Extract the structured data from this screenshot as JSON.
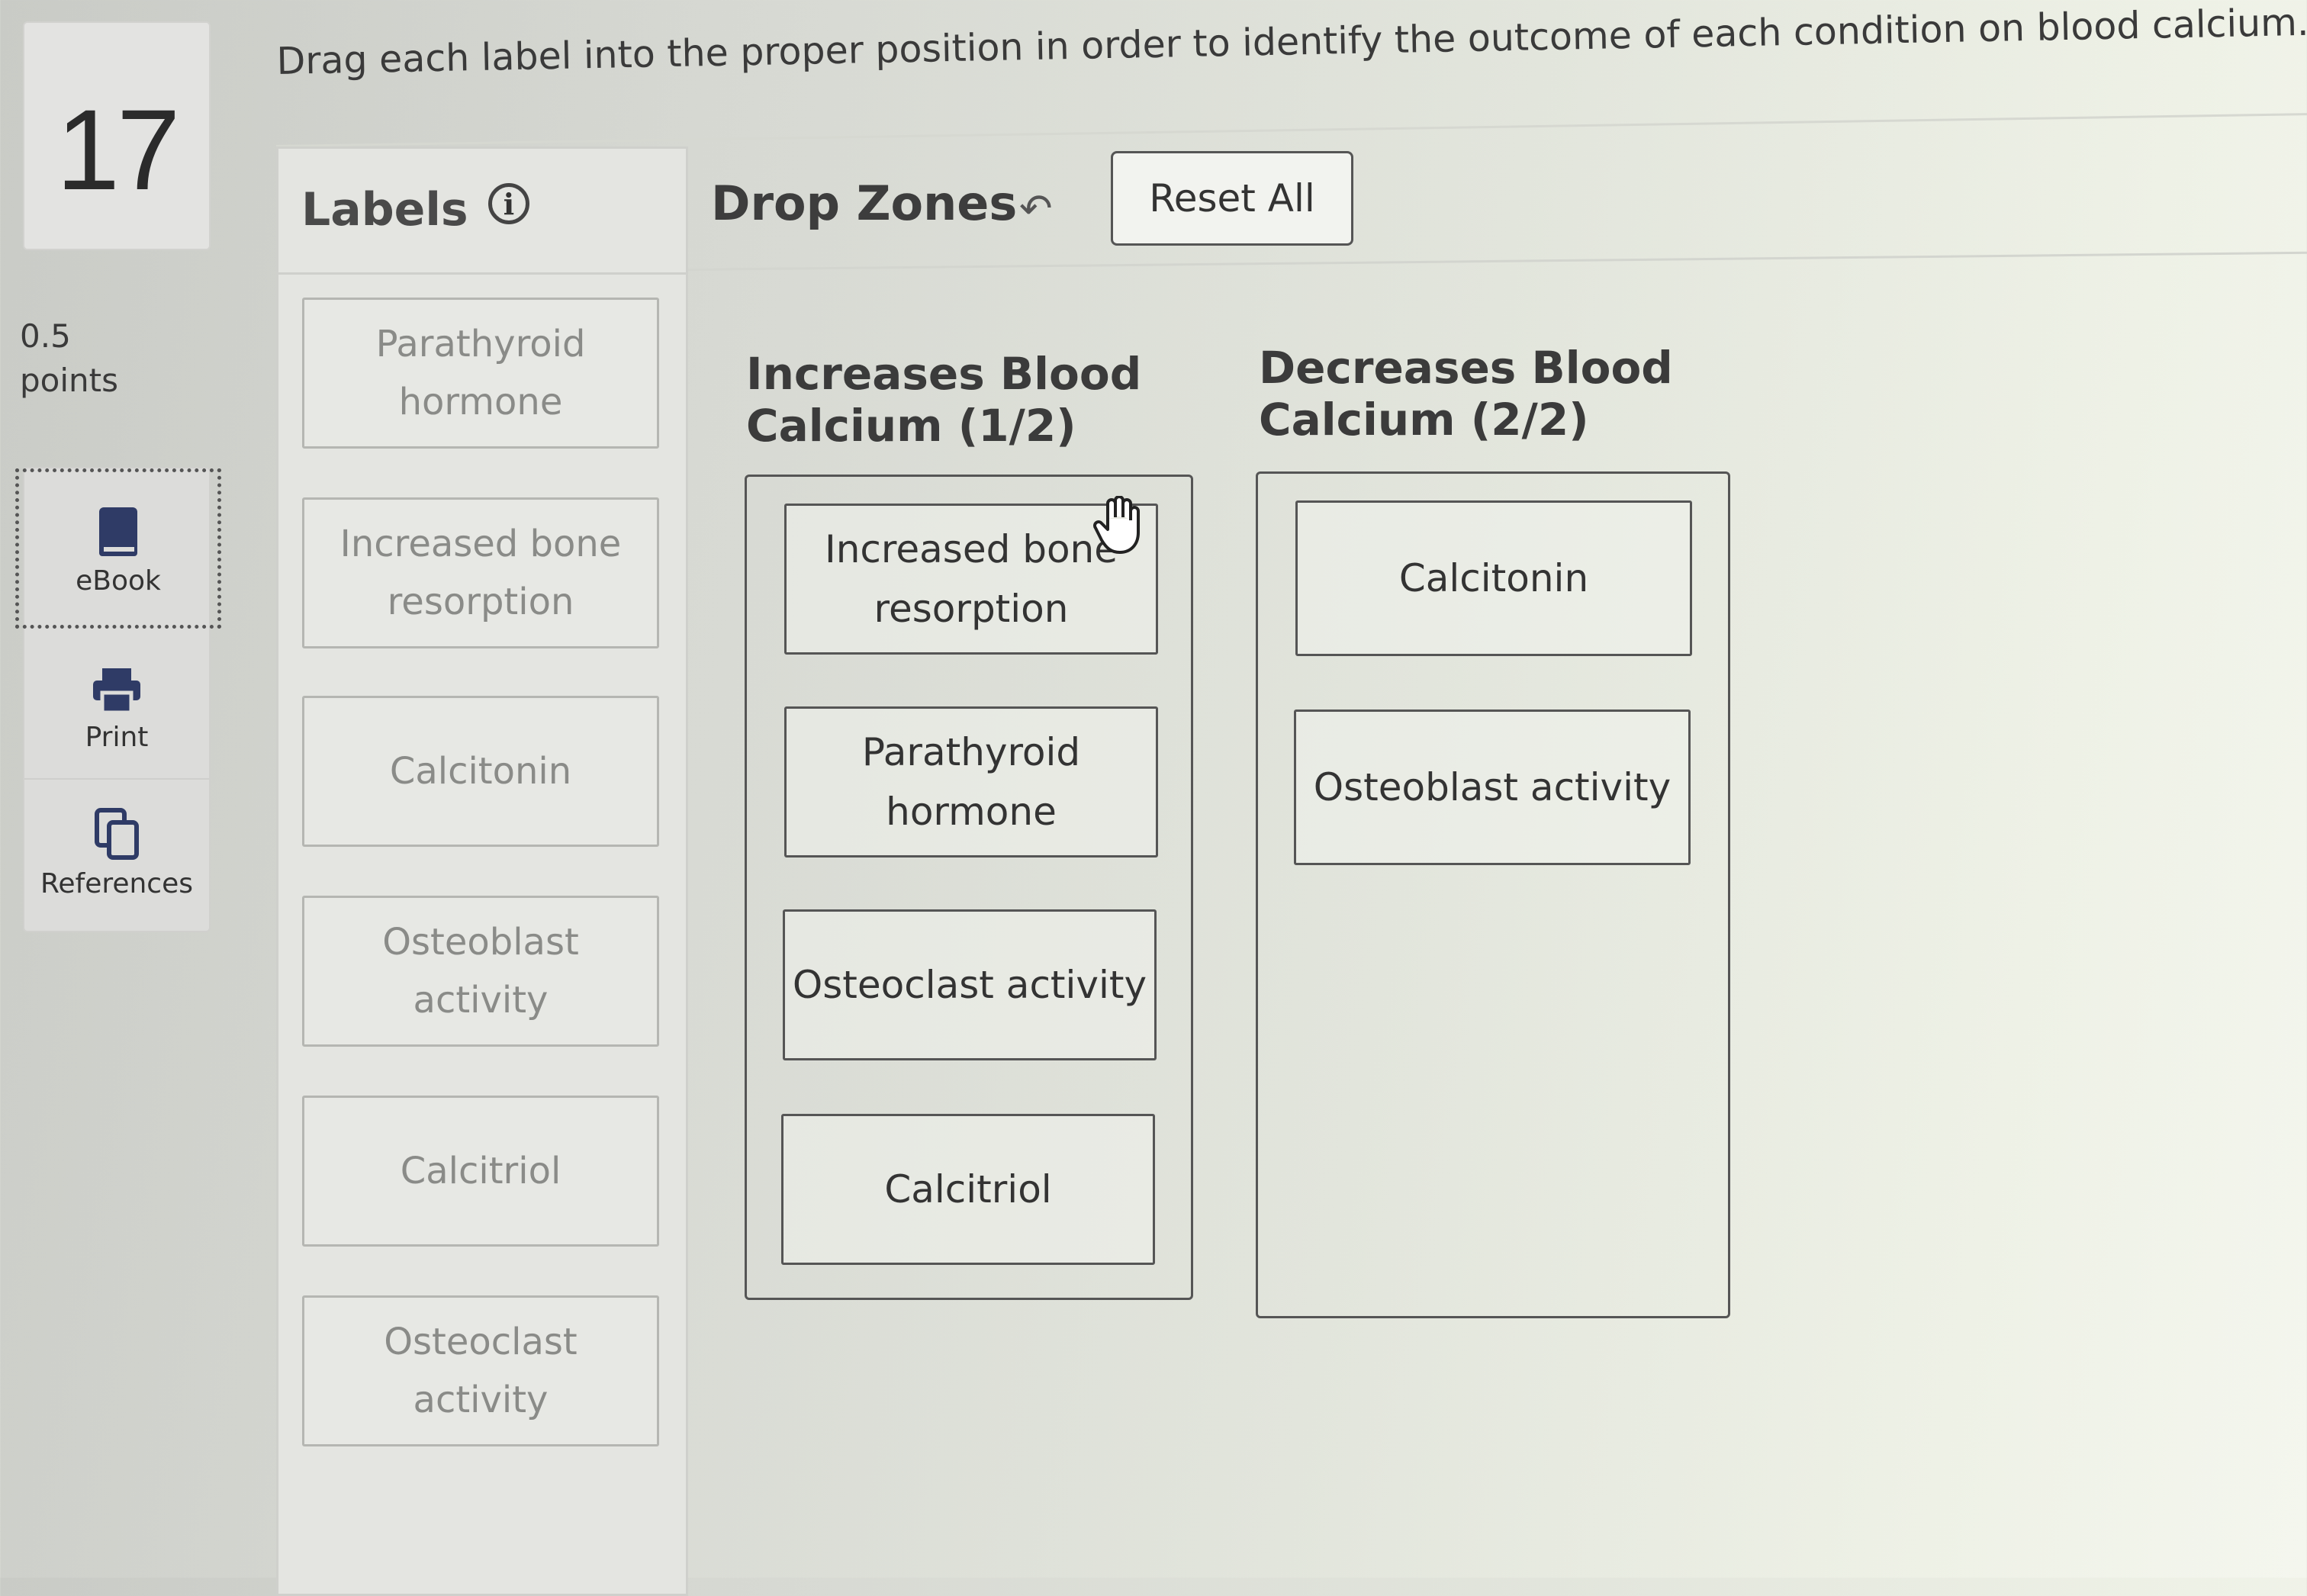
{
  "question": {
    "number": "17",
    "points_value": "0.5",
    "points_label": "points"
  },
  "tools": [
    {
      "label": "eBook",
      "icon": "book-icon"
    },
    {
      "label": "Print",
      "icon": "printer-icon"
    },
    {
      "label": "References",
      "icon": "copy-icon"
    }
  ],
  "instructions": "Drag each label into the proper position in order to identify the outcome of each condition on blood calcium.",
  "labels_panel": {
    "title": "Labels",
    "info_icon": "info-icon",
    "items": [
      "Parathyroid hormone",
      "Increased bone resorption",
      "Calcitonin",
      "Osteoblast activity",
      "Calcitriol",
      "Osteoclast activity"
    ]
  },
  "drop_panel": {
    "title": "Drop Zones",
    "undo_icon": "undo-arrow-icon",
    "reset_label": "Reset All",
    "zones": [
      {
        "heading_line1": "Increases Blood",
        "heading_line2": "Calcium (1/2)",
        "items": [
          "Increased bone resorption",
          "Parathyroid hormone",
          "Osteoclast activity",
          "Calcitriol"
        ]
      },
      {
        "heading_line1": "Decreases Blood",
        "heading_line2": "Calcium (2/2)",
        "items": [
          "Calcitonin",
          "Osteoblast activity"
        ]
      }
    ]
  },
  "colors": {
    "border_dark": "#555555",
    "label_text_faded": "#8a8b88",
    "text": "#333333"
  }
}
